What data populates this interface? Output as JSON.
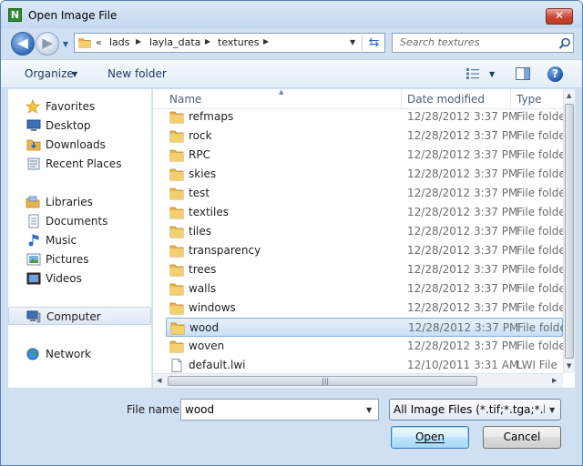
{
  "window": {
    "title": "Open Image File",
    "close_label": "✕"
  },
  "address": {
    "overflow": "«",
    "crumbs": [
      "lads",
      "layla_data",
      "textures"
    ]
  },
  "search": {
    "placeholder": "Search textures"
  },
  "toolbar": {
    "organize_label": "Organize",
    "new_folder_label": "New folder"
  },
  "nav": {
    "favorites": {
      "label": "Favorites",
      "items": [
        "Desktop",
        "Downloads",
        "Recent Places"
      ]
    },
    "libraries": {
      "label": "Libraries",
      "items": [
        "Documents",
        "Music",
        "Pictures",
        "Videos"
      ]
    },
    "computer": "Computer",
    "network": "Network"
  },
  "columns": {
    "name": "Name",
    "date": "Date modified",
    "type": "Type"
  },
  "files": [
    {
      "name": "refmaps",
      "date": "12/28/2012 3:37 PM",
      "type": "File folder",
      "kind": "folder"
    },
    {
      "name": "rock",
      "date": "12/28/2012 3:37 PM",
      "type": "File folder",
      "kind": "folder"
    },
    {
      "name": "RPC",
      "date": "12/28/2012 3:37 PM",
      "type": "File folder",
      "kind": "folder"
    },
    {
      "name": "skies",
      "date": "12/28/2012 3:37 PM",
      "type": "File folder",
      "kind": "folder"
    },
    {
      "name": "test",
      "date": "12/28/2012 3:37 PM",
      "type": "File folder",
      "kind": "folder"
    },
    {
      "name": "textiles",
      "date": "12/28/2012 3:37 PM",
      "type": "File folder",
      "kind": "folder"
    },
    {
      "name": "tiles",
      "date": "12/28/2012 3:37 PM",
      "type": "File folder",
      "kind": "folder"
    },
    {
      "name": "transparency",
      "date": "12/28/2012 3:37 PM",
      "type": "File folder",
      "kind": "folder"
    },
    {
      "name": "trees",
      "date": "12/28/2012 3:37 PM",
      "type": "File folder",
      "kind": "folder"
    },
    {
      "name": "walls",
      "date": "12/28/2012 3:37 PM",
      "type": "File folder",
      "kind": "folder"
    },
    {
      "name": "windows",
      "date": "12/28/2012 3:37 PM",
      "type": "File folder",
      "kind": "folder"
    },
    {
      "name": "wood",
      "date": "12/28/2012 3:37 PM",
      "type": "File folder",
      "kind": "folder",
      "selected": true
    },
    {
      "name": "woven",
      "date": "12/28/2012 3:37 PM",
      "type": "File folder",
      "kind": "folder"
    },
    {
      "name": "default.lwi",
      "date": "12/10/2011 3:31 AM",
      "type": "LWI File",
      "kind": "file"
    }
  ],
  "bottom": {
    "file_name_label": "File name:",
    "file_name_value": "wood",
    "filter_value": "All Image Files (*.tif;*.tga;*.bmp",
    "open_label": "Open",
    "cancel_label": "Cancel"
  },
  "colors": {
    "accent": "#3c7fb1",
    "folder": "#e8b54a",
    "selection": "#c9dff7"
  }
}
